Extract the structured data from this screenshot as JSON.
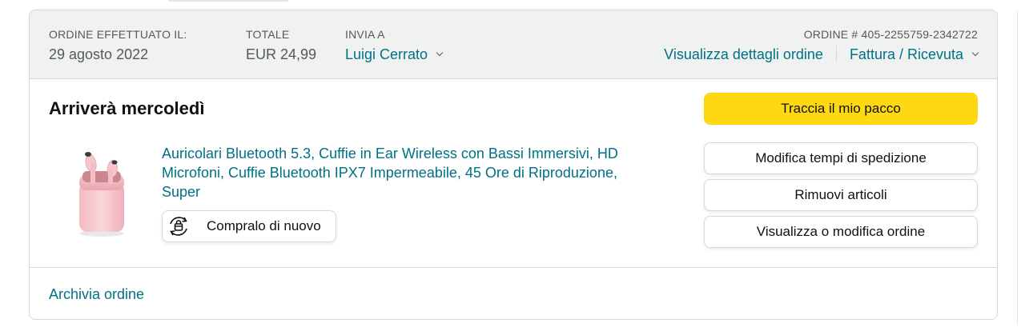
{
  "header": {
    "order_date_label": "ORDINE EFFETTUATO IL:",
    "order_date_value": "29 agosto 2022",
    "total_label": "TOTALE",
    "total_value": "EUR 24,99",
    "ship_to_label": "INVIA A",
    "ship_to_name": "Luigi Cerrato",
    "order_number_label": "ORDINE # 405-2255759-2342722",
    "order_details_link": "Visualizza dettagli ordine",
    "invoice_link": "Fattura / Ricevuta"
  },
  "shipment": {
    "status_title": "Arriverà mercoledì"
  },
  "product": {
    "title": "Auricolari Bluetooth 5.3, Cuffie in Ear Wireless con Bassi Immersivi, HD Microfoni, Cuffie Bluetooth IPX7 Impermeabile, 45 Ore di Riproduzione, Super",
    "buy_again_label": "Compralo di nuovo",
    "buy_again_icon": "buy-again-icon",
    "image_color": "#f6c9cf"
  },
  "actions": {
    "track_package": "Traccia il mio pacco",
    "change_delivery": "Modifica tempi di spedizione",
    "remove_items": "Rimuovi articoli",
    "view_edit_order": "Visualizza o modifica ordine"
  },
  "footer": {
    "archive_order": "Archivia ordine"
  },
  "colors": {
    "link": "#007185",
    "primary_button": "#ffd814",
    "header_bg": "#f0f2f2",
    "border": "#d5d9d9"
  }
}
